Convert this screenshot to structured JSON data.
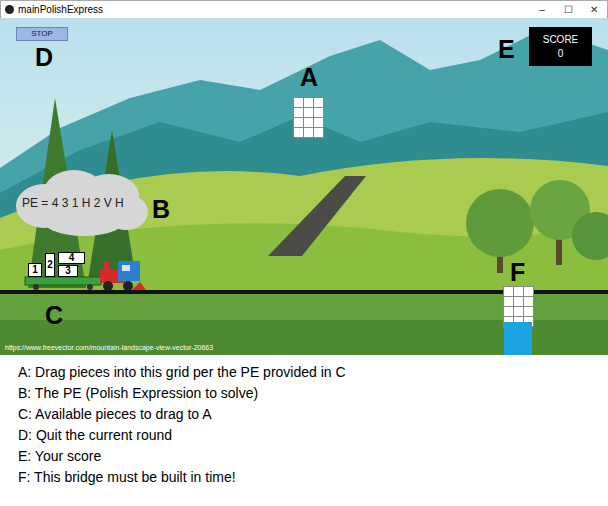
{
  "window": {
    "title": "mainPolishExpress",
    "controls": [
      "–",
      "☐",
      "✕"
    ]
  },
  "stop_button": {
    "label": "STOP"
  },
  "score": {
    "label": "SCORE",
    "value": "0"
  },
  "pe": {
    "text": "PE = 4 3 1 H 2 V H"
  },
  "markers": [
    {
      "letter": "D"
    },
    {
      "letter": "A"
    },
    {
      "letter": "E"
    },
    {
      "letter": "B"
    },
    {
      "letter": "F"
    },
    {
      "letter": "C"
    }
  ],
  "pieces": [
    {
      "label": "1"
    },
    {
      "label": "2"
    },
    {
      "label": "4"
    },
    {
      "label": "3"
    }
  ],
  "credit": "https://www.freevector.com/mountain-landscape-view-vector-20663",
  "legend": [
    "A: Drag pieces into this grid per the PE provided in C",
    "B: The PE (Polish Expression to solve)",
    "C: Available pieces to drag to A",
    "D: Quit the current round",
    "E: Your score",
    "F: This bridge must be built in time!"
  ]
}
